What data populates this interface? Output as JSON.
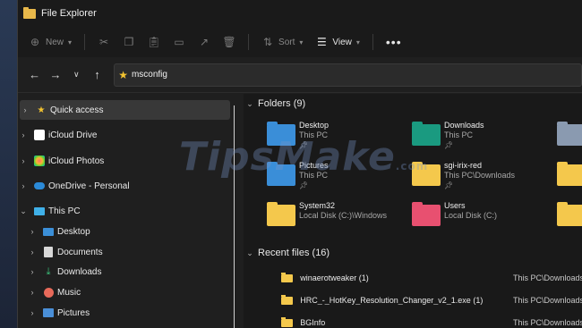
{
  "window": {
    "title": "File Explorer"
  },
  "toolbar": {
    "new_label": "New",
    "sort_label": "Sort",
    "view_label": "View",
    "more_label": "•••"
  },
  "address": {
    "path": "msconfig"
  },
  "sidebar": {
    "items": [
      {
        "label": "Quick access"
      },
      {
        "label": "iCloud Drive"
      },
      {
        "label": "iCloud Photos"
      },
      {
        "label": "OneDrive - Personal"
      },
      {
        "label": "This PC"
      },
      {
        "label": "Desktop"
      },
      {
        "label": "Documents"
      },
      {
        "label": "Downloads"
      },
      {
        "label": "Music"
      },
      {
        "label": "Pictures"
      }
    ]
  },
  "folders": {
    "header": "Folders (9)",
    "items": [
      {
        "name": "Desktop",
        "location": "This PC"
      },
      {
        "name": "Downloads",
        "location": "This PC"
      },
      {
        "name": "Pictures",
        "location": "This PC"
      },
      {
        "name": "sgi-irix-red",
        "location": "This PC\\Downloads"
      },
      {
        "name": "System32",
        "location": "Local Disk (C:)\\Windows"
      },
      {
        "name": "Users",
        "location": "Local Disk (C:)"
      }
    ]
  },
  "recent": {
    "header": "Recent files (16)",
    "items": [
      {
        "name": "winaerotweaker (1)",
        "location": "This PC\\Downloads"
      },
      {
        "name": "HRC_-_HotKey_Resolution_Changer_v2_1.exe (1)",
        "location": "This PC\\Downloads"
      },
      {
        "name": "BGInfo",
        "location": "This PC\\Downloads"
      }
    ]
  },
  "watermark": {
    "text": "TipsMake",
    "suffix": ".com"
  }
}
